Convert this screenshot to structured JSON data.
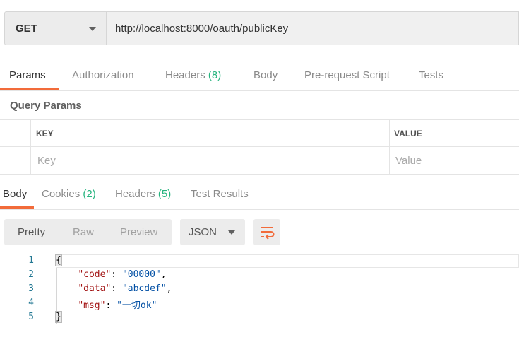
{
  "request": {
    "method": "GET",
    "url": "http://localhost:8000/oauth/publicKey"
  },
  "request_tabs": [
    {
      "label": "Params",
      "count": ""
    },
    {
      "label": "Authorization",
      "count": ""
    },
    {
      "label": "Headers",
      "count": "(8)"
    },
    {
      "label": "Body",
      "count": ""
    },
    {
      "label": "Pre-request Script",
      "count": ""
    },
    {
      "label": "Tests",
      "count": ""
    }
  ],
  "query_params": {
    "title": "Query Params",
    "columns": [
      "KEY",
      "VALUE"
    ],
    "key_placeholder": "Key",
    "value_placeholder": "Value"
  },
  "response_tabs": [
    {
      "label": "Body",
      "count": ""
    },
    {
      "label": "Cookies",
      "count": "(2)"
    },
    {
      "label": "Headers",
      "count": "(5)"
    },
    {
      "label": "Test Results",
      "count": ""
    }
  ],
  "view_modes": [
    "Pretty",
    "Raw",
    "Preview"
  ],
  "format": "JSON",
  "colors": {
    "accent": "#f26b3a",
    "count": "#26b47f"
  },
  "response_body": {
    "line_numbers": [
      "1",
      "2",
      "3",
      "4",
      "5"
    ],
    "open_brace": "{",
    "close_brace": "}",
    "fields": [
      {
        "key": "\"code\"",
        "value": "\"00000\""
      },
      {
        "key": "\"data\"",
        "value": "\"abcdef\""
      },
      {
        "key": "\"msg\"",
        "value": "\"一切ok\""
      }
    ]
  }
}
